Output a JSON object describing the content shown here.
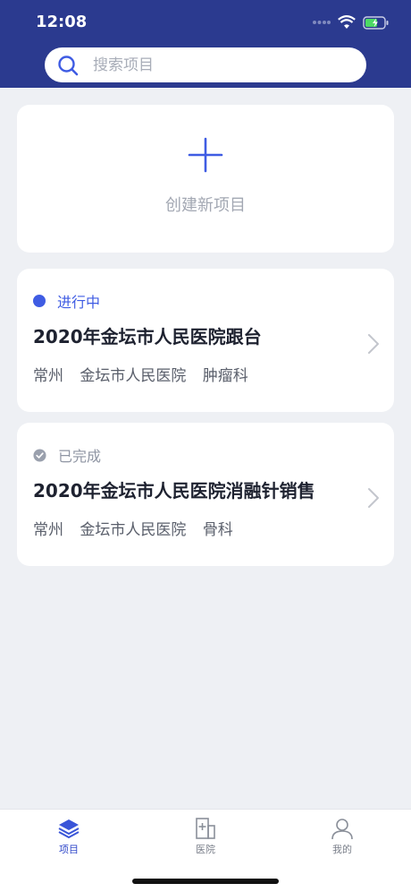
{
  "status_bar": {
    "time": "12:08"
  },
  "search": {
    "placeholder": "搜索项目"
  },
  "create": {
    "label": "创建新项目"
  },
  "projects": [
    {
      "status": "进行中",
      "title": "2020年金坛市人民医院跟台",
      "city": "常州",
      "hospital": "金坛市人民医院",
      "department": "肿瘤科"
    },
    {
      "status": "已完成",
      "title": "2020年金坛市人民医院消融针销售",
      "city": "常州",
      "hospital": "金坛市人民医院",
      "department": "骨科"
    }
  ],
  "tabbar": {
    "items": [
      {
        "label": "项目",
        "icon": "layers-icon"
      },
      {
        "label": "医院",
        "icon": "hospital-icon"
      },
      {
        "label": "我的",
        "icon": "person-icon"
      }
    ]
  },
  "colors": {
    "header": "#2b3a8f",
    "accent": "#3f5ce3",
    "background": "#eef0f4"
  }
}
